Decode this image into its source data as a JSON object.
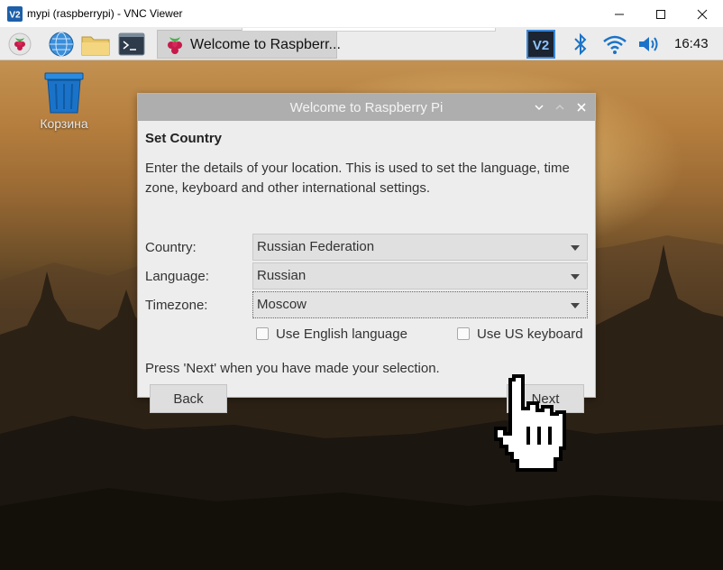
{
  "vnc": {
    "title": "mypi (raspberrypi) - VNC Viewer",
    "logo_text": "V2"
  },
  "panel": {
    "task_label": "Welcome to Raspberr...",
    "clock": "16:43",
    "tray_vnc_text": "V2"
  },
  "desktop": {
    "trash_label": "Корзина"
  },
  "dialog": {
    "title": "Welcome to Raspberry Pi",
    "heading": "Set Country",
    "description": "Enter the details of your location. This is used to set the language, time zone, keyboard and other international settings.",
    "country_label": "Country:",
    "country_value": "Russian Federation",
    "language_label": "Language:",
    "language_value": "Russian",
    "timezone_label": "Timezone:",
    "timezone_value": "Moscow",
    "english_label": "Use English language",
    "us_keyboard_label": "Use US keyboard",
    "hint": "Press 'Next' when you have made your selection.",
    "back_label": "Back",
    "next_label": "Next"
  },
  "colors": {
    "panel_bg": "#ececec",
    "dialog_titlebar": "#aeaeae",
    "vnc_blue": "#1d5fa8",
    "raspberry_red": "#c51a4a",
    "trash_blue": "#1a73c8"
  }
}
